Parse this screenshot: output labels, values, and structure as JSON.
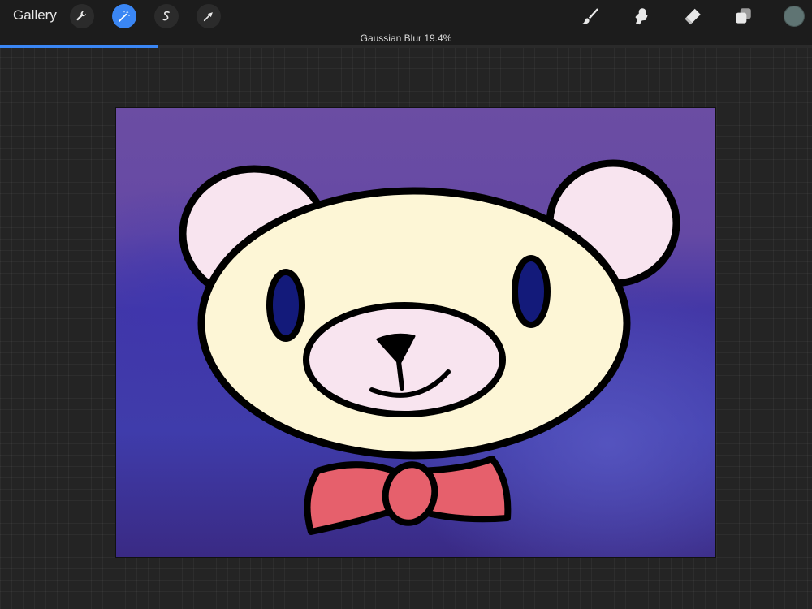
{
  "toolbar": {
    "gallery_label": "Gallery",
    "left_tools": [
      {
        "name": "adjustments",
        "icon": "wrench-icon"
      },
      {
        "name": "adjust-magic",
        "icon": "magic-wand-icon"
      },
      {
        "name": "selection",
        "icon": "selection-s-icon"
      },
      {
        "name": "transform",
        "icon": "arrow-cursor-icon"
      }
    ],
    "right_tools": [
      {
        "name": "brush",
        "icon": "brush-icon"
      },
      {
        "name": "smudge",
        "icon": "smudge-icon"
      },
      {
        "name": "eraser",
        "icon": "eraser-icon"
      },
      {
        "name": "layers",
        "icon": "layers-icon"
      }
    ],
    "current_color": "#5f7473",
    "accent_color": "#3a86f4"
  },
  "status": {
    "label": "Gaussian Blur 19.4%",
    "progress_percent": 19.4
  },
  "canvas": {
    "background_top": "#6b4da3",
    "background_mid": "#3f3fa8",
    "background_bottom": "#3a2a84",
    "bear_face_color": "#fdf6d6",
    "ear_color": "#f8e4ef",
    "eye_color": "#131a7a",
    "bow_color": "#e6606c"
  }
}
